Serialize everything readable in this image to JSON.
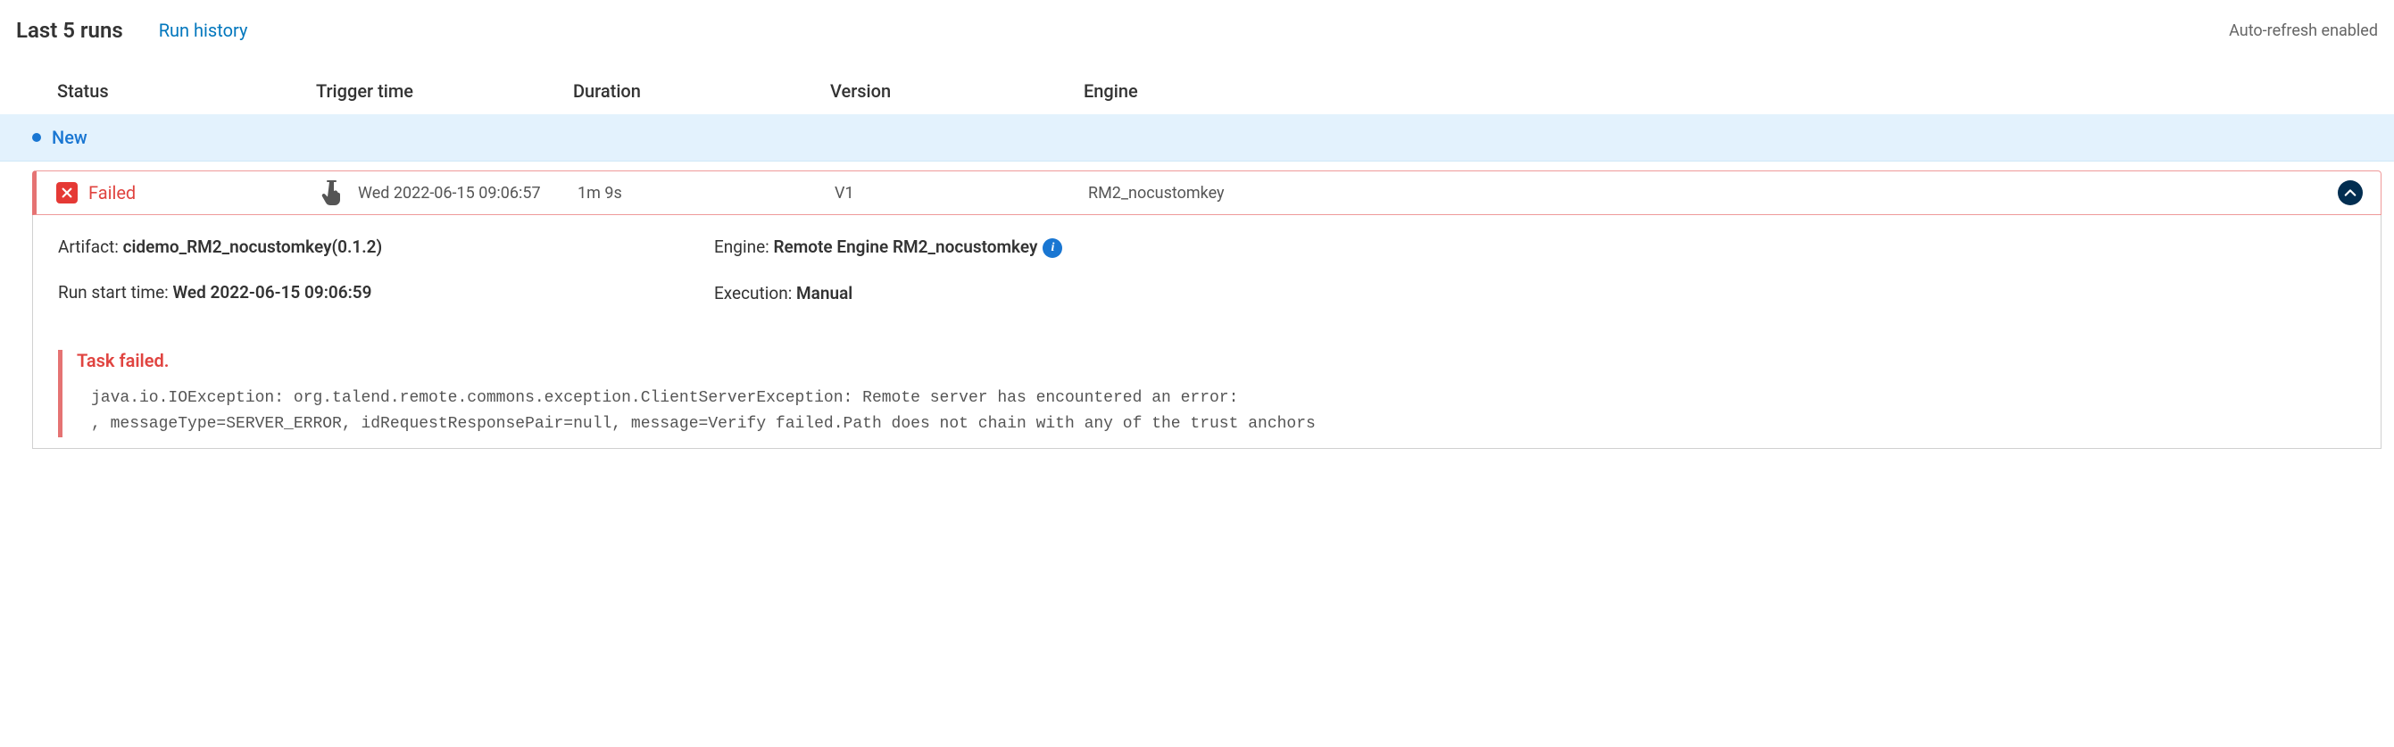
{
  "header": {
    "title": "Last 5 runs",
    "history_link": "Run history",
    "auto_refresh": "Auto-refresh enabled"
  },
  "columns": {
    "status": "Status",
    "trigger": "Trigger time",
    "duration": "Duration",
    "version": "Version",
    "engine": "Engine"
  },
  "new_banner": "New",
  "run": {
    "status": "Failed",
    "trigger_time": "Wed 2022-06-15 09:06:57",
    "duration": "1m 9s",
    "version": "V1",
    "engine": "RM2_nocustomkey"
  },
  "details": {
    "artifact_label": "Artifact: ",
    "artifact_value": "cidemo_RM2_nocustomkey(0.1.2)",
    "engine_label": "Engine: ",
    "engine_value": "Remote Engine RM2_nocustomkey",
    "run_start_label": "Run start time: ",
    "run_start_value": "Wed 2022-06-15 09:06:59",
    "execution_label": "Execution: ",
    "execution_value": "Manual"
  },
  "error": {
    "title": "Task failed.",
    "trace": "java.io.IOException: org.talend.remote.commons.exception.ClientServerException: Remote server has encountered an error:\n, messageType=SERVER_ERROR, idRequestResponsePair=null, message=Verify failed.Path does not chain with any of the trust anchors"
  }
}
